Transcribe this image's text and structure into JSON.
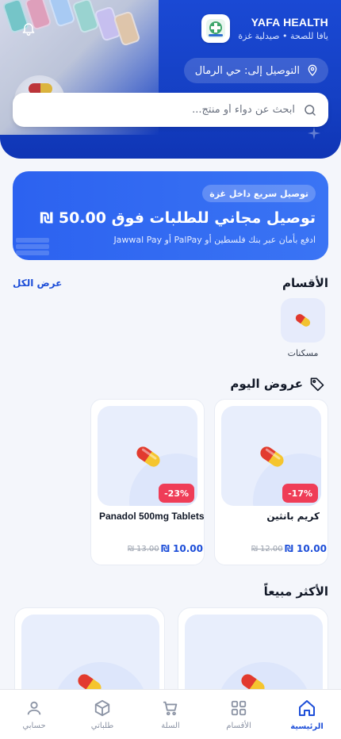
{
  "header": {
    "brand_name": "YAFA HEALTH",
    "brand_subtitle": "يافا للصحة • صيدلية غزة",
    "delivery_label": "التوصيل إلى: حي الرمال"
  },
  "search": {
    "placeholder": "ابحث عن دواء أو منتج..."
  },
  "promo": {
    "tag": "توصيل سريع داخل غزة",
    "title": "توصيل مجاني للطلبات فوق 50.00 ₪",
    "subtitle": "ادفع بأمان عبر بنك فلسطين أو PalPay أو Jawwal Pay"
  },
  "categories": {
    "title": "الأقسام",
    "view_all": "عرض الكل",
    "items": [
      {
        "label": "مسكنات",
        "icon": "pill-icon"
      }
    ]
  },
  "offers": {
    "title": "عروض اليوم",
    "icon": "tag-icon",
    "products": [
      {
        "name": "كريم بانثين",
        "discount": "-17%",
        "price": "₪ 10.00",
        "old_price": "₪ 12.00"
      },
      {
        "name": "Panadol 500mg Tablets",
        "discount": "-23%",
        "price": "₪ 10.00",
        "old_price": "₪ 13.00"
      }
    ]
  },
  "best_sellers": {
    "title": "الأكثر مبيعاً"
  },
  "bottom_nav": {
    "items": [
      {
        "label": "الرئيسية",
        "icon": "home-icon",
        "active": true
      },
      {
        "label": "الأقسام",
        "icon": "grid-icon",
        "active": false
      },
      {
        "label": "السلة",
        "icon": "cart-icon",
        "active": false
      },
      {
        "label": "طلباتي",
        "icon": "box-icon",
        "active": false
      },
      {
        "label": "حسابي",
        "icon": "user-icon",
        "active": false
      }
    ]
  },
  "colors": {
    "primary": "#1a49d4",
    "accent": "#1d4ed8",
    "badge": "#ef3d57"
  }
}
